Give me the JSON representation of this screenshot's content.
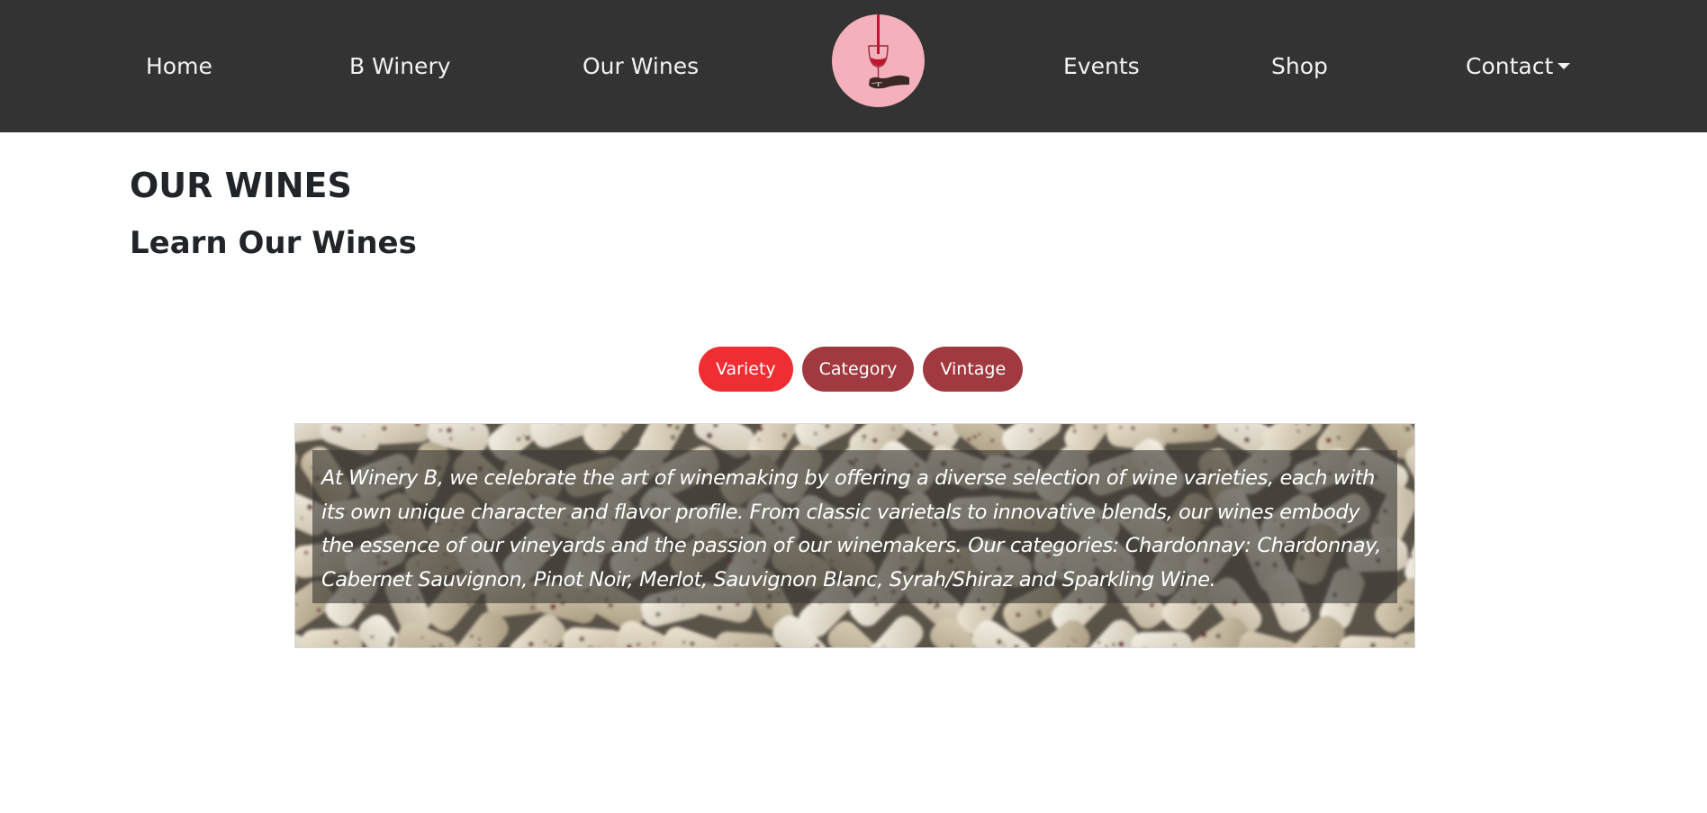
{
  "nav": {
    "items": [
      {
        "label": "Home"
      },
      {
        "label": "B Winery"
      },
      {
        "label": "Our Wines"
      },
      {
        "label": "Events"
      },
      {
        "label": "Shop"
      },
      {
        "label": "Contact"
      }
    ],
    "logo_icon": "wine-glass-pour-icon"
  },
  "main": {
    "title": "OUR WINES",
    "subtitle": "Learn Our Wines",
    "filters": [
      {
        "label": "Variety",
        "active": true
      },
      {
        "label": "Category",
        "active": false
      },
      {
        "label": "Vintage",
        "active": false
      }
    ],
    "description": "At Winery B, we celebrate the art of winemaking by offering a diverse selection of wine varieties, each with its own unique character and flavor profile. From classic varietals to innovative blends, our wines embody the essence of our vineyards and the passion of our winemakers. Our categories: Chardonnay: Chardonnay, Cabernet Sauvignon, Pinot Noir, Merlot, Sauvignon Blanc, Syrah/Shiraz and Sparkling Wine."
  },
  "colors": {
    "navbar_bg": "#333333",
    "logo_bg": "#f4b0bb",
    "wine_red": "#c0152f",
    "filter_active": "#ef2d32",
    "filter_inactive": "#a03a40"
  }
}
